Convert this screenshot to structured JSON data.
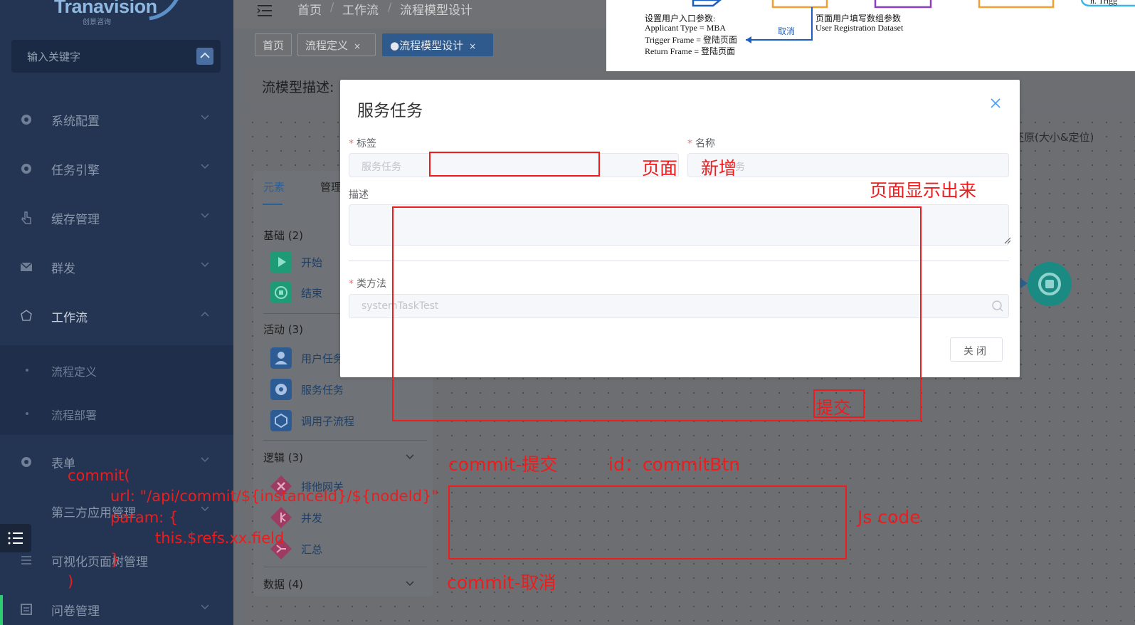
{
  "sidebar": {
    "logo_text": "Tranavision",
    "logo_sub": "创景咨询",
    "search_placeholder": "输入关键字",
    "menu": [
      {
        "label": "系统配置",
        "icon": "gear-icon"
      },
      {
        "label": "任务引擎",
        "icon": "gear-icon"
      },
      {
        "label": "缓存管理",
        "icon": "hand-pointer-icon"
      },
      {
        "label": "群发",
        "icon": "mail-icon"
      },
      {
        "label": "工作流",
        "icon": "workflow-icon"
      },
      {
        "label": "表单",
        "icon": "gear-icon"
      },
      {
        "label": "第三方应用管理",
        "icon": ""
      },
      {
        "label": "可视化页面树管理",
        "icon": "list-icon"
      },
      {
        "label": "问卷管理",
        "icon": "survey-icon"
      }
    ],
    "submenu": [
      "流程定义",
      "流程部署"
    ]
  },
  "breadcrumb": [
    "首页",
    "工作流",
    "流程模型设计"
  ],
  "tabs": [
    {
      "label": "首页"
    },
    {
      "label": "流程定义",
      "close": "×"
    },
    {
      "label": "●流程模型设计",
      "close": "×"
    }
  ],
  "description_label": "流模型描述:",
  "toolbar": {
    "restore": "还原(大小&定位)"
  },
  "palette": {
    "tabs": [
      "元素",
      "管理"
    ],
    "groups": [
      {
        "label": "基础 (2)",
        "items": [
          "开始",
          "结束"
        ]
      },
      {
        "label": "活动 (3)",
        "items": [
          "用户任务",
          "服务任务",
          "调用子流程"
        ]
      },
      {
        "label": "逻辑 (3)",
        "items": [
          "排他网关",
          "并发",
          "汇总"
        ]
      },
      {
        "label": "数据 (4)",
        "items": []
      }
    ]
  },
  "flow_diagram": {
    "lines": [
      "设置用户入口参数:",
      "Applicant Type = MBA",
      "Trigger Frame = 登陆页面",
      "Return Frame = 登陆页面"
    ],
    "cancel": "取消",
    "right_lines": [
      "页面用户填写数组参数",
      "User Registration Dataset"
    ],
    "corner": "n. Trigg"
  },
  "dialog": {
    "title": "服务任务",
    "label_field": {
      "label": "标签",
      "value": "服务任务"
    },
    "name_field": {
      "label": "名称",
      "value": "务"
    },
    "desc_field": {
      "label": "描述"
    },
    "method_field": {
      "label": "类方法",
      "value": "systemTaskTest"
    },
    "close_button": "关闭"
  },
  "annotations": {
    "page": "页面",
    "add": "新增",
    "page_show": "页面显示出来",
    "submit": "提交",
    "commit_submit": "commit-提交",
    "commit_id": "id：commitBtn",
    "js_code": "Js code",
    "commit_cancel": "commit-取消",
    "code_lines": [
      "commit(",
      "url: \"/api/commit/${instanceId}/${nodeId}\"",
      "param: {",
      "this.$refs.xx.field",
      "}",
      ")"
    ]
  },
  "colors": {
    "sidebar_bg": "#243554",
    "accent": "#2f5a8e",
    "annotation_red": "#ee1c1c",
    "stop_node": "#1b8a83"
  }
}
